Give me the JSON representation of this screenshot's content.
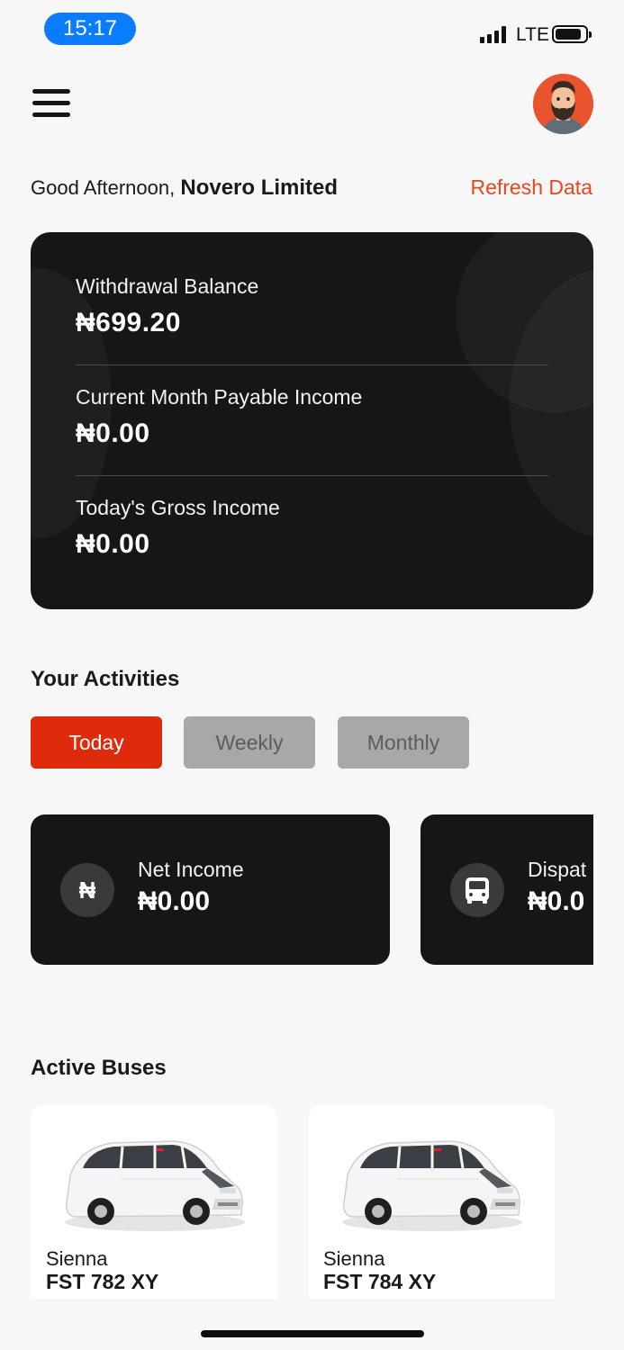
{
  "status_bar": {
    "time": "15:17",
    "network": "LTE"
  },
  "header": {
    "menu_icon": "hamburger-icon",
    "avatar_icon": "bearded-man-avatar"
  },
  "greeting": {
    "prefix": "Good Afternoon,",
    "name": "Novero Limited",
    "refresh_label": "Refresh Data"
  },
  "balances": [
    {
      "label": "Withdrawal Balance",
      "value": "₦699.20"
    },
    {
      "label": "Current Month Payable Income",
      "value": "₦0.00"
    },
    {
      "label": "Today's Gross Income",
      "value": "₦0.00"
    }
  ],
  "activities": {
    "title": "Your Activities",
    "tabs": [
      {
        "label": "Today",
        "active": true
      },
      {
        "label": "Weekly",
        "active": false
      },
      {
        "label": "Monthly",
        "active": false
      }
    ],
    "cards": [
      {
        "icon": "naira-icon",
        "icon_glyph": "₦",
        "label": "Net Income",
        "value": "₦0.00"
      },
      {
        "icon": "bus-icon",
        "label": "Dispat",
        "value": "₦0.0"
      }
    ]
  },
  "active_buses": {
    "title": "Active Buses",
    "items": [
      {
        "model": "Sienna",
        "plate": "FST 782 XY",
        "image": "white-minivan-image"
      },
      {
        "model": "Sienna",
        "plate": "FST 784 XY",
        "image": "white-minivan-image"
      }
    ]
  },
  "colors": {
    "accent": "#e8461f",
    "active_tab": "#dd2b0c",
    "card_bg": "#161616",
    "inactive_tab": "#a8a8a8"
  }
}
